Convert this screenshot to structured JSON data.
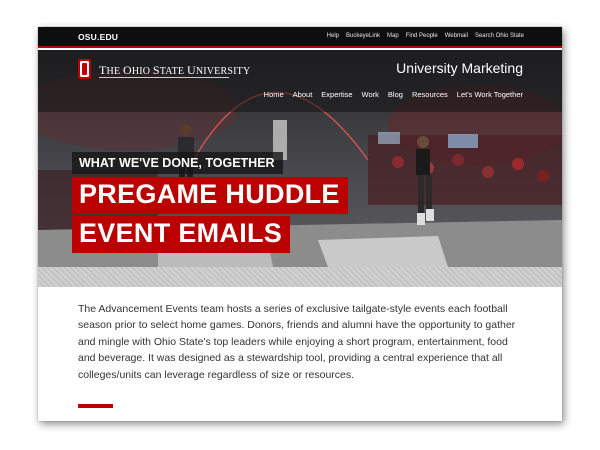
{
  "top_bar": {
    "site": "OSU.EDU",
    "links": [
      "Help",
      "BuckeyeLink",
      "Map",
      "Find People",
      "Webmail",
      "Search Ohio State"
    ]
  },
  "header": {
    "university_cap_T": "T",
    "university_he": "HE ",
    "university_cap_O": "O",
    "university_hio": "HIO ",
    "university_cap_S": "S",
    "university_tate": "TATE ",
    "university_cap_U": "U",
    "university_niversity": "NIVERSITY",
    "unit": "University Marketing"
  },
  "nav": [
    "Home",
    "About",
    "Expertise",
    "Work",
    "Blog",
    "Resources",
    "Let's Work Together"
  ],
  "hero": {
    "kicker": "WHAT WE'VE DONE, TOGETHER",
    "title_line_1": "PREGAME HUDDLE",
    "title_line_2": "EVENT EMAILS"
  },
  "body": {
    "paragraph": "The Advancement Events team hosts a series of exclusive tailgate-style events each football season prior to select home games. Donors, friends and alumni have the opportunity to gather and mingle with Ohio State's top leaders while enjoying a short program, entertainment, food and beverage. It was designed as a stewardship tool, providing a central experience that all colleges/units can leverage regardless of size or resources."
  },
  "colors": {
    "scarlet": "#bb0000",
    "black_bar": "#0e0e0e"
  },
  "icons": [
    "block-o-logo-icon"
  ]
}
